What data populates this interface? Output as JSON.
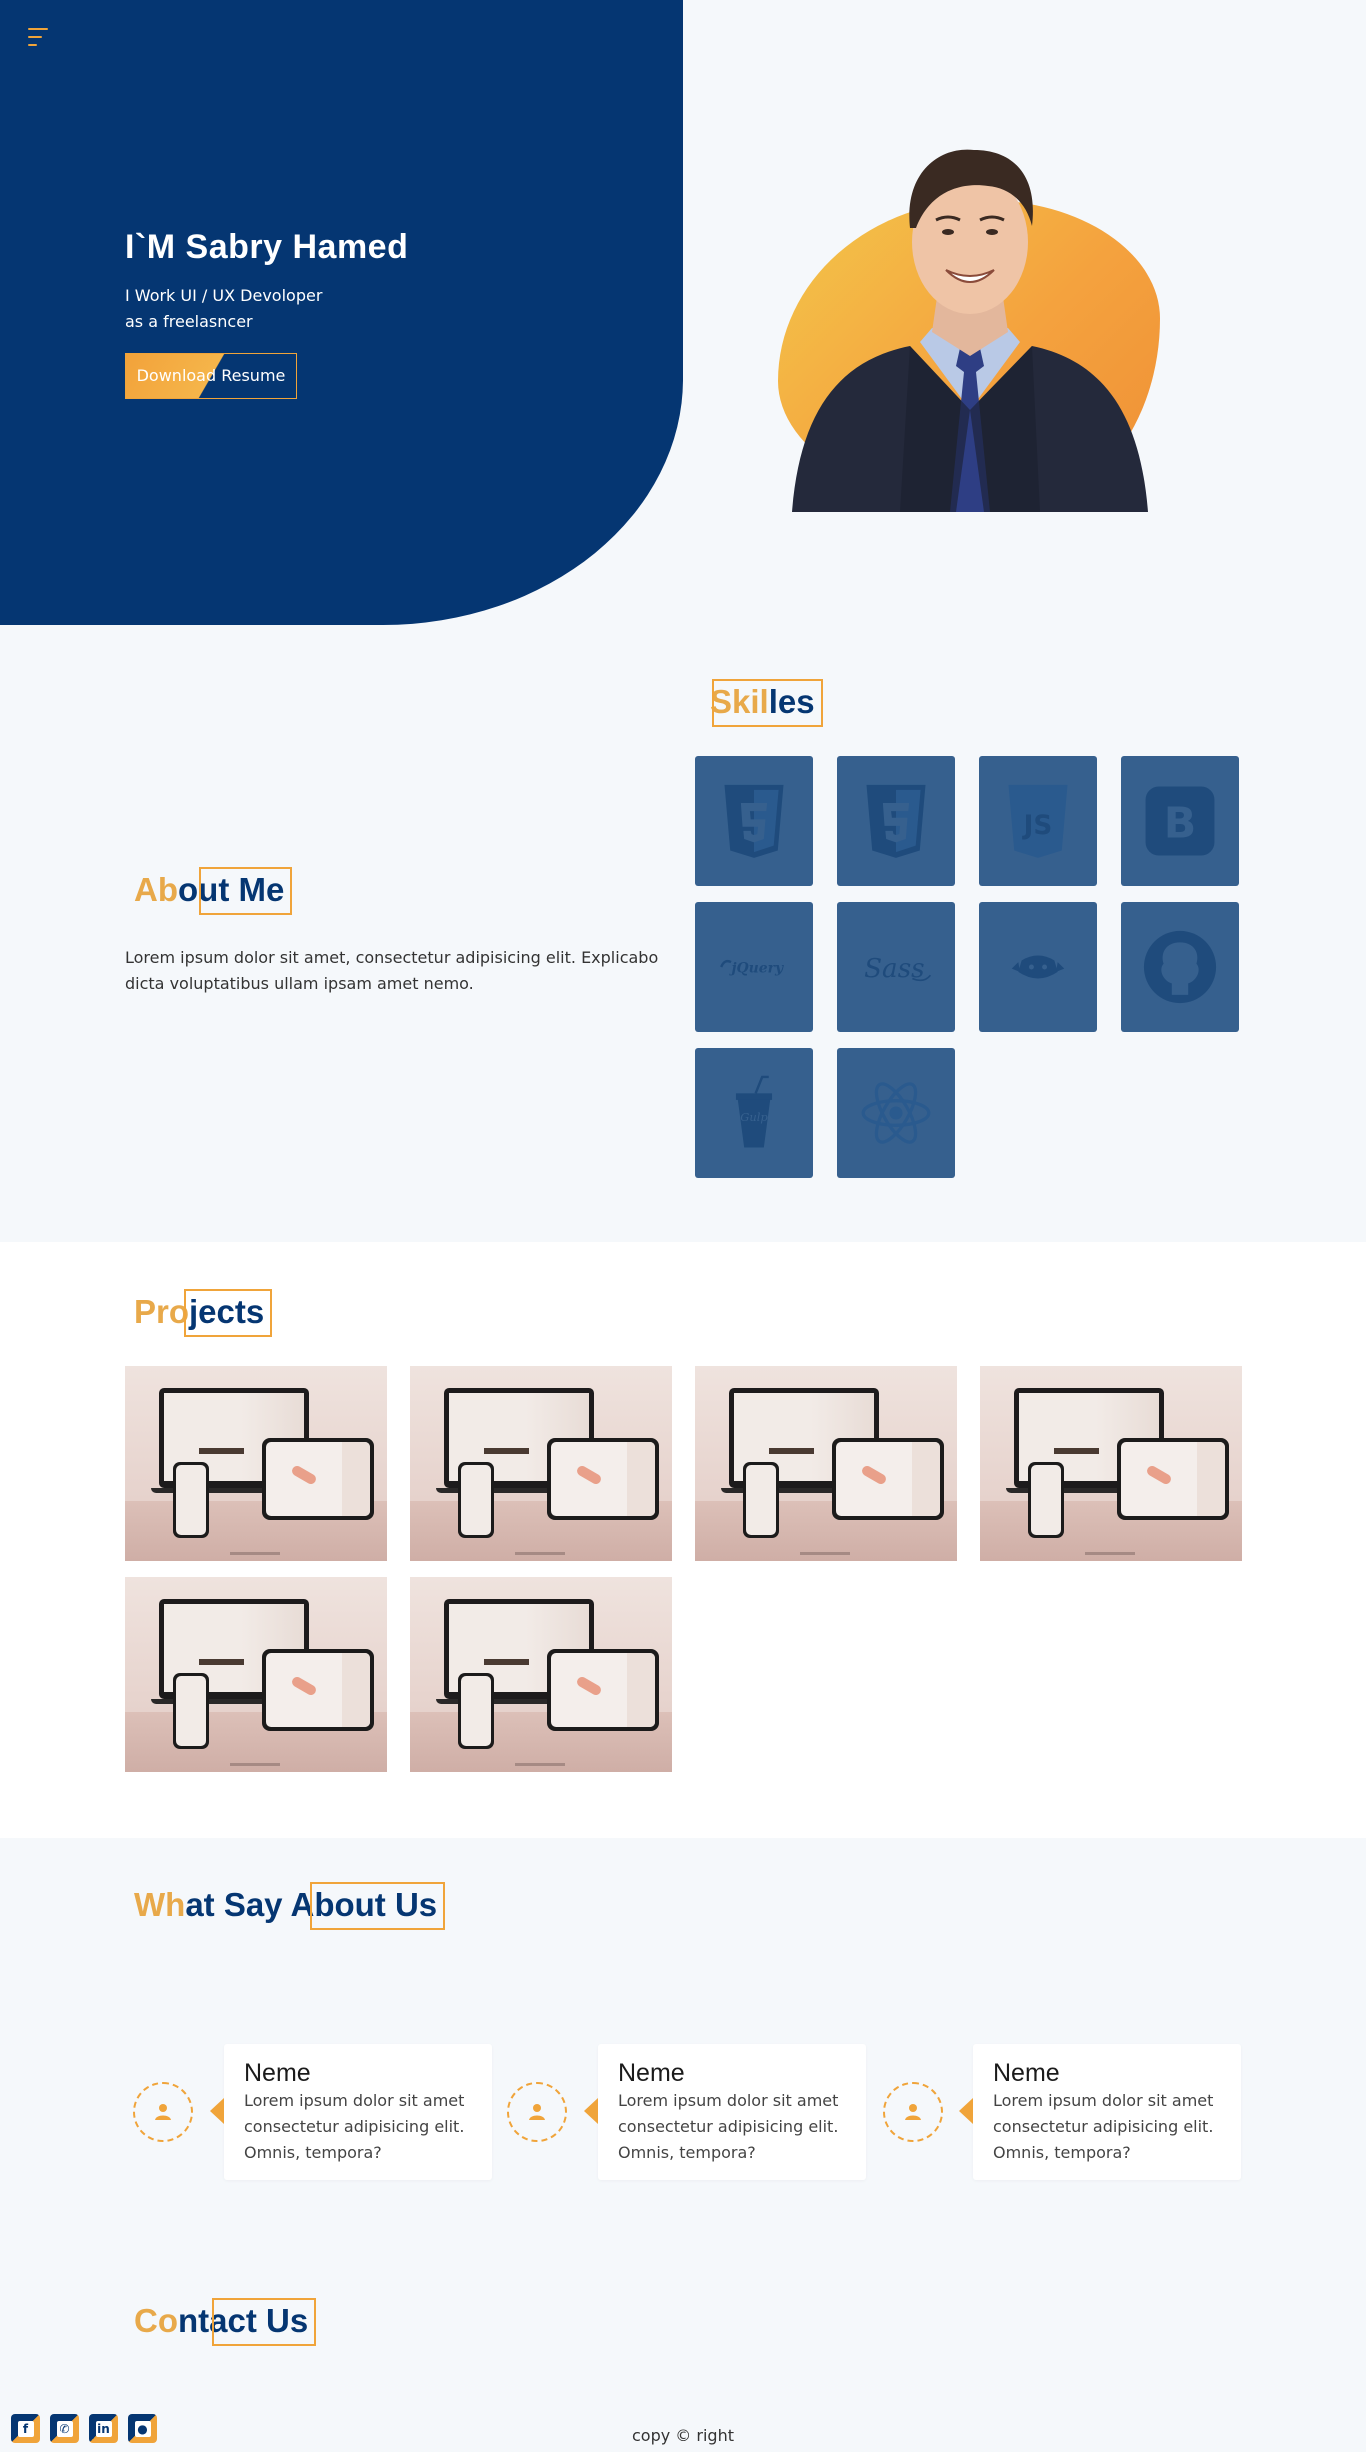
{
  "hero": {
    "title": "I`M Sabry Hamed",
    "subtitle_line1": "I Work UI / UX Devoloper",
    "subtitle_line2": "as a freelasncer",
    "resume_button": "Download Resume",
    "menu_icon": "hamburger-menu-icon"
  },
  "skills": {
    "title_hl": "Skil",
    "title_rest": "les",
    "items": [
      "html5-icon",
      "css3-icon",
      "javascript-icon",
      "bootstrap-icon",
      "jquery-icon",
      "sass-icon",
      "pug-icon",
      "github-icon",
      "gulp-icon",
      "react-icon"
    ]
  },
  "about": {
    "title_hl": "Ab",
    "title_rest": "out Me",
    "text": "Lorem ipsum dolor sit amet, consectetur adipisicing elit. Explicabo dicta voluptatibus ullam ipsam amet nemo."
  },
  "projects": {
    "title_hl": "Pro",
    "title_rest": "jects",
    "count": 6
  },
  "testimonials": {
    "title_hl": "Wh",
    "title_rest": "at Say About Us",
    "items": [
      {
        "name": "Neme",
        "text": "Lorem ipsum dolor sit amet consectetur adipisicing elit. Omnis, tempora?"
      },
      {
        "name": "Neme",
        "text": "Lorem ipsum dolor sit amet consectetur adipisicing elit. Omnis, tempora?"
      },
      {
        "name": "Neme",
        "text": "Lorem ipsum dolor sit amet consectetur adipisicing elit. Omnis, tempora?"
      }
    ]
  },
  "contact": {
    "title_hl": "Co",
    "title_rest": "ntact Us",
    "socials": [
      "facebook-icon",
      "whatsapp-icon",
      "linkedin-icon",
      "github-icon"
    ],
    "copyright": "copy © right"
  },
  "colors": {
    "navy": "#053672",
    "orange": "#f0a43a",
    "tile": "#36608e"
  }
}
